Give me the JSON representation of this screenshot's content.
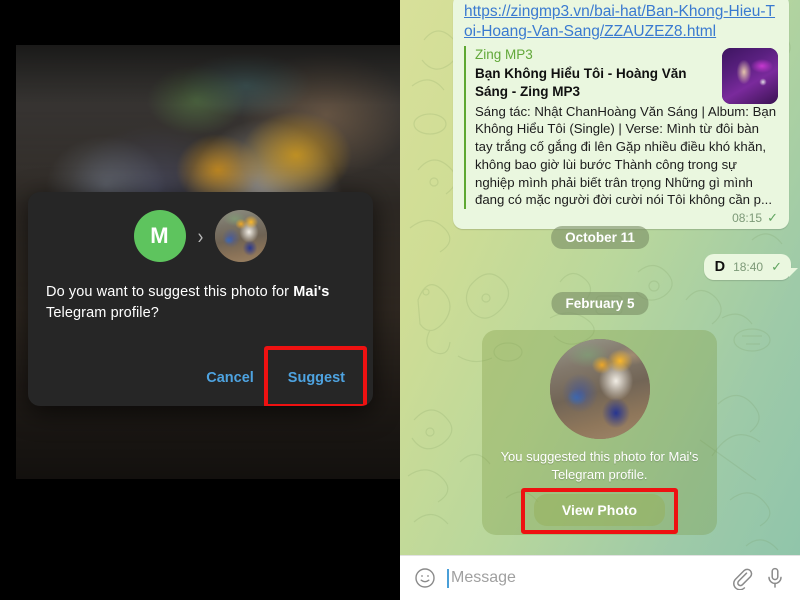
{
  "left_panel": {
    "name": "telegram-photo-viewer-with-dialog",
    "dialog": {
      "avatar_initial": "M",
      "arrow_glyph": "›",
      "message_prefix": "Do you want to suggest this photo for ",
      "message_bold": "Mai's",
      "message_suffix": " Telegram profile?",
      "cancel_label": "Cancel",
      "suggest_label": "Suggest",
      "accent_color": "#4ea3e0",
      "background_color": "#262626",
      "avatar_color": "#5ec45e"
    },
    "highlight": {
      "target": "suggest-button",
      "color": "#ee1111"
    }
  },
  "right_panel": {
    "name": "telegram-chat-thread",
    "link_message": {
      "url": "https://zingmp3.vn/bai-hat/Ban-Khong-Hieu-Toi-Hoang-Van-Sang/ZZAUZEZ8.html",
      "preview": {
        "site_name": "Zing MP3",
        "title": "Bạn Không Hiểu Tôi - Hoàng Văn Sáng - Zing MP3",
        "description": "Sáng tác: Nhật ChanHoàng Văn Sáng | Album: Bạn Không Hiểu Tôi (Single) | Verse:   Mình từ đôi bàn tay trắng cố gắng đi lên  Gặp nhiều điều khó khăn, không bao giờ lùi bước  Thành công trong sự nghiệp mình phải biết trân trọng  Những gì mình đang có mặc người đời cười nói  Tôi không cần p...",
        "thumbnail_name": "album-art-thumbnail",
        "accent_color": "#5ea832"
      },
      "time": "08:15",
      "status_glyph": "✓"
    },
    "date_separators": [
      {
        "label": "October 11"
      },
      {
        "label": "February 5"
      }
    ],
    "short_message": {
      "text": "D",
      "time": "18:40",
      "status_glyph": "✓"
    },
    "suggested_photo_message": {
      "photo_name": "suggested-profile-photo",
      "caption": "You suggested this photo for Mai's Telegram profile.",
      "button_label": "View Photo"
    },
    "highlight": {
      "target": "view-photo-button",
      "color": "#ee1111"
    },
    "input_bar": {
      "placeholder": "Message",
      "value": "",
      "emoji_icon": "emoji-icon",
      "attach_icon": "paperclip-icon",
      "mic_icon": "microphone-icon"
    }
  }
}
